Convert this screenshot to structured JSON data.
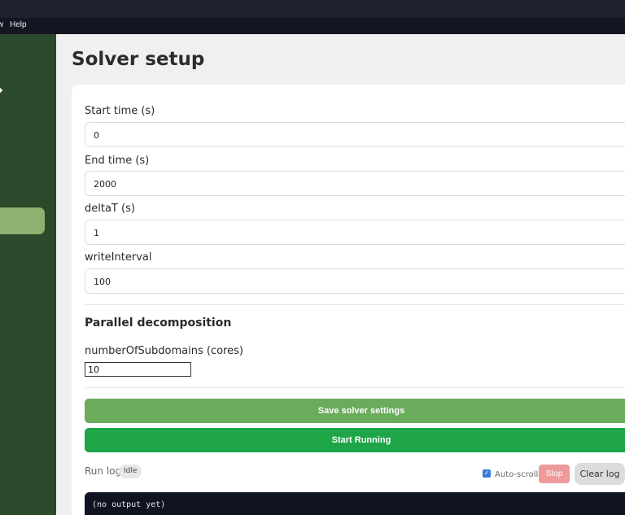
{
  "menubar": {
    "items": [
      "w",
      "Help"
    ]
  },
  "page": {
    "title": "Solver setup"
  },
  "solver": {
    "start_time": {
      "label": "Start time (s)",
      "value": "0"
    },
    "end_time": {
      "label": "End time (s)",
      "value": "2000"
    },
    "delta_t": {
      "label": "deltaT (s)",
      "value": "1"
    },
    "write_interval": {
      "label": "writeInterval",
      "value": "100"
    }
  },
  "parallel": {
    "title": "Parallel decomposition",
    "subdomains_label": "numberOfSubdomains (cores)",
    "subdomains_value": "10"
  },
  "buttons": {
    "save": "Save solver settings",
    "run": "Start Running",
    "stop": "Stop",
    "clear": "Clear log"
  },
  "runlog": {
    "label": "Run log",
    "status": "Idle",
    "autoscroll_label": "Auto-scroll",
    "autoscroll_checked": true,
    "output": "(no output yet)"
  },
  "colors": {
    "sidebar": "#2b4a2b",
    "active_nav": "#8fb070",
    "save_button": "#6aab5c",
    "run_button": "#1ea548",
    "stop_button": "#ee9a9a",
    "log_background": "#0f1322"
  }
}
